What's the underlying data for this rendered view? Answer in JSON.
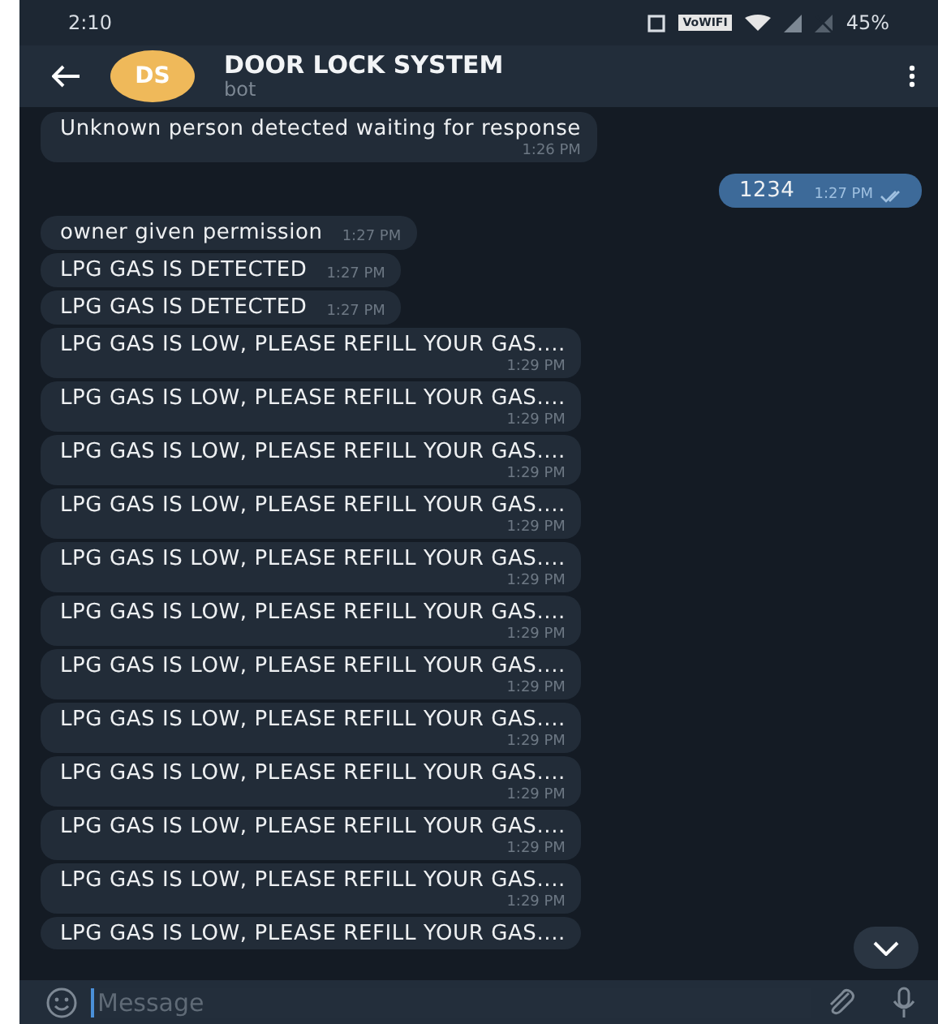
{
  "status_bar": {
    "time": "2:10",
    "network_label": "VoWIFI",
    "battery": "45%"
  },
  "header": {
    "avatar": "DS",
    "title": "DOOR LOCK SYSTEM",
    "subtitle": "bot"
  },
  "messages": [
    {
      "kind": "incoming_wide",
      "text": "Unknown person detected waiting for response",
      "time": "1:26 PM"
    },
    {
      "kind": "outgoing",
      "text": "1234",
      "time": "1:27 PM",
      "read": true
    },
    {
      "kind": "incoming",
      "text": "owner given permission",
      "time": "1:27 PM"
    },
    {
      "kind": "incoming",
      "text": "LPG GAS IS DETECTED",
      "time": "1:27 PM"
    },
    {
      "kind": "incoming",
      "text": "LPG GAS IS DETECTED",
      "time": "1:27 PM"
    },
    {
      "kind": "incoming_wide",
      "text": "LPG GAS IS LOW, PLEASE REFILL YOUR GAS....",
      "time": "1:29 PM"
    },
    {
      "kind": "incoming_wide",
      "text": "LPG GAS IS LOW, PLEASE REFILL YOUR GAS....",
      "time": "1:29 PM"
    },
    {
      "kind": "incoming_wide",
      "text": "LPG GAS IS LOW, PLEASE REFILL YOUR GAS....",
      "time": "1:29 PM"
    },
    {
      "kind": "incoming_wide",
      "text": "LPG GAS IS LOW, PLEASE REFILL YOUR GAS....",
      "time": "1:29 PM"
    },
    {
      "kind": "incoming_wide",
      "text": "LPG GAS IS LOW, PLEASE REFILL YOUR GAS....",
      "time": "1:29 PM"
    },
    {
      "kind": "incoming_wide",
      "text": "LPG GAS IS LOW, PLEASE REFILL YOUR GAS....",
      "time": "1:29 PM"
    },
    {
      "kind": "incoming_wide",
      "text": "LPG GAS IS LOW, PLEASE REFILL YOUR GAS....",
      "time": "1:29 PM"
    },
    {
      "kind": "incoming_wide",
      "text": "LPG GAS IS LOW, PLEASE REFILL YOUR GAS....",
      "time": "1:29 PM"
    },
    {
      "kind": "incoming_wide",
      "text": "LPG GAS IS LOW, PLEASE REFILL YOUR GAS....",
      "time": "1:29 PM"
    },
    {
      "kind": "incoming_wide",
      "text": "LPG GAS IS LOW, PLEASE REFILL YOUR GAS....",
      "time": "1:29 PM"
    },
    {
      "kind": "incoming_wide",
      "text": "LPG GAS IS LOW, PLEASE REFILL YOUR GAS....",
      "time": "1:29 PM"
    },
    {
      "kind": "incoming_wide",
      "text": "LPG GAS IS LOW, PLEASE REFILL YOUR GAS...."
    }
  ],
  "composer": {
    "placeholder": "Message"
  }
}
